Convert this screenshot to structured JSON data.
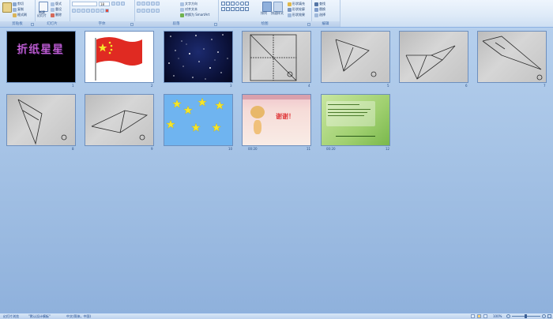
{
  "ribbon": {
    "groups": [
      {
        "label": "剪贴板"
      },
      {
        "label": "幻灯片"
      },
      {
        "label": "字体"
      },
      {
        "label": "段落"
      },
      {
        "label": "绘图"
      },
      {
        "label": "编辑"
      }
    ],
    "clipboard": {
      "cut": "剪切",
      "copy": "复制",
      "format_painter": "格式刷"
    },
    "slides": {
      "new_slide_top": "新建",
      "new_slide_bottom": "幻灯片",
      "layout": "版式",
      "reset": "重设",
      "delete": "删除"
    },
    "font": {
      "name": "",
      "size": "18"
    },
    "paragraph": {
      "text_direction": "文字方向",
      "align_text": "对齐文本",
      "smartart": "转换为 SmartArt"
    },
    "drawing": {
      "arrange": "排列",
      "quick_styles": "快速样式",
      "shape_fill": "形状填充",
      "shape_outline": "形状轮廓",
      "shape_effects": "形状效果"
    },
    "editing": {
      "find": "查找",
      "replace": "替换",
      "select": "选择"
    }
  },
  "slides": [
    {
      "number": "1",
      "title": "折纸星星"
    },
    {
      "number": "2"
    },
    {
      "number": "3"
    },
    {
      "number": "4"
    },
    {
      "number": "5"
    },
    {
      "number": "6"
    },
    {
      "number": "7"
    },
    {
      "number": "8"
    },
    {
      "number": "9"
    },
    {
      "number": "10"
    },
    {
      "number": "11",
      "duration": "00:20",
      "thanks": "谢谢！"
    },
    {
      "number": "12",
      "duration": "00:20"
    }
  ],
  "status": {
    "view": "幻灯片浏览",
    "theme": "\"默认设计模板\"",
    "language": "中文(简体，中国)",
    "zoom": "100%"
  },
  "colors": {
    "ribbon_bg": "#dfebf8",
    "workspace": "#a7c4e6",
    "accent_border": "#8db2e3",
    "flag_red": "#e02a22",
    "star_yellow": "#f5e62a"
  }
}
